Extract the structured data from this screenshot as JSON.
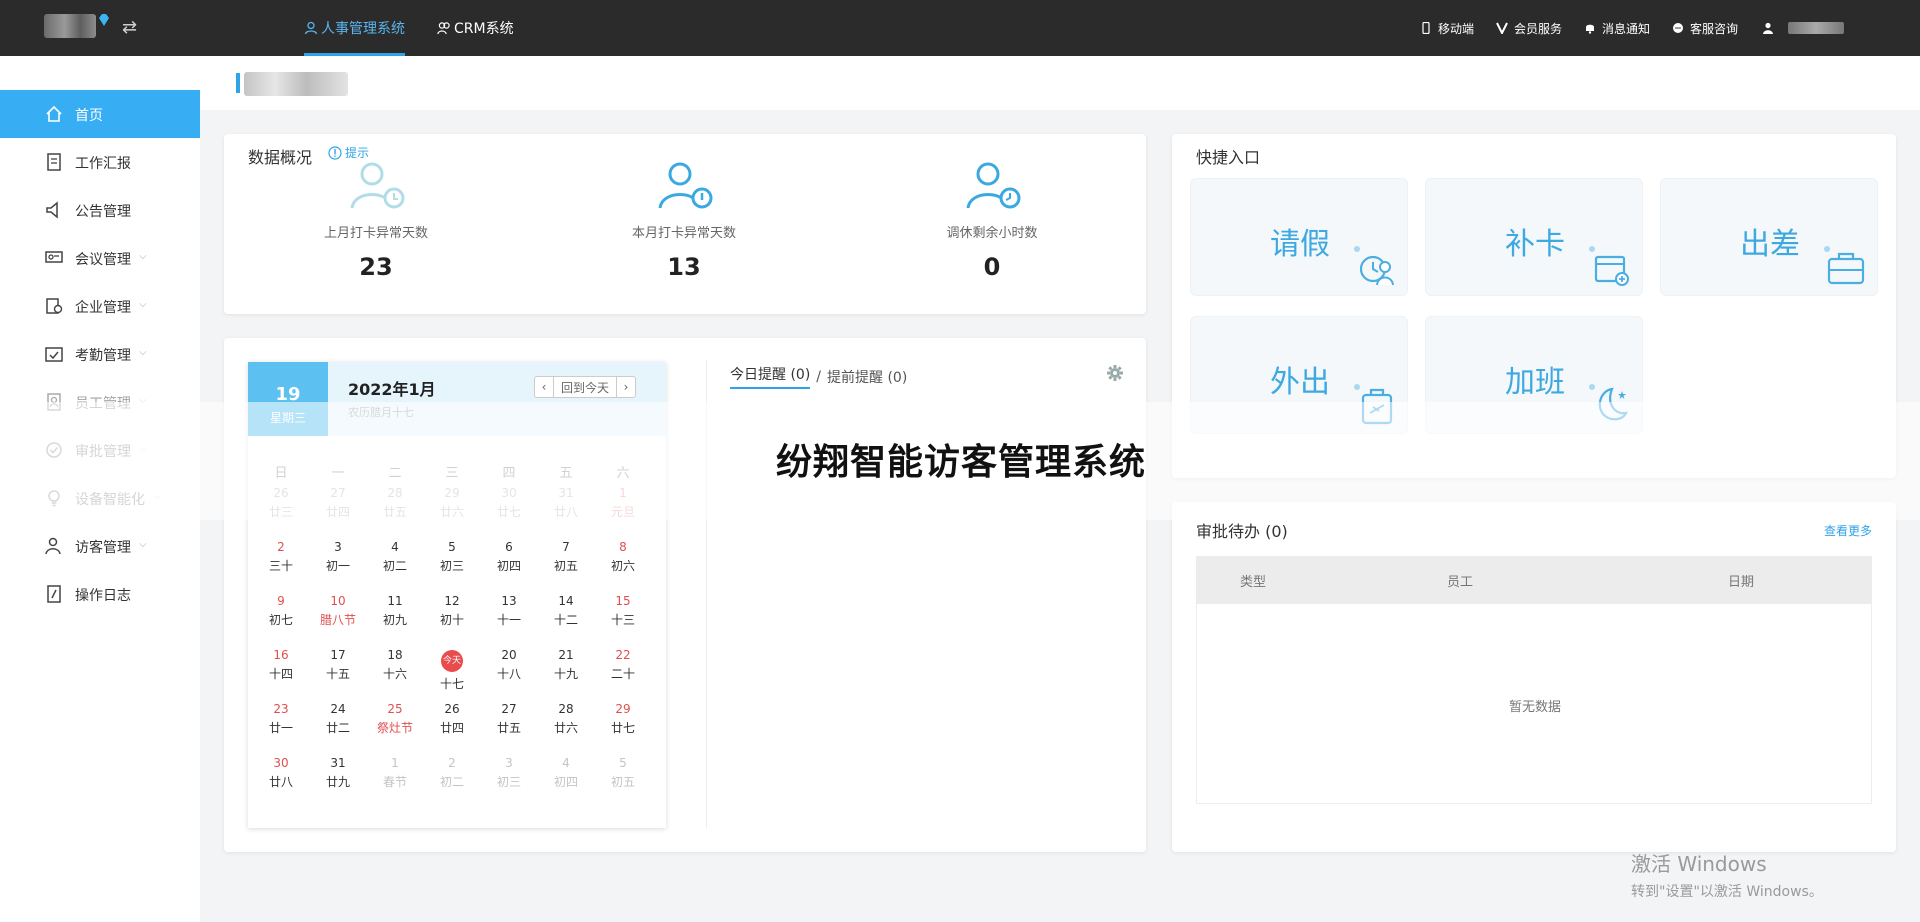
{
  "topbar": {
    "systems": [
      {
        "label": "人事管理系统",
        "active": true
      },
      {
        "label": "CRM系统",
        "active": false
      }
    ],
    "right_items": [
      {
        "label": "移动端",
        "icon": "mobile-icon"
      },
      {
        "label": "会员服务",
        "icon": "vip-icon"
      },
      {
        "label": "消息通知",
        "icon": "bell-icon"
      },
      {
        "label": "客服咨询",
        "icon": "chat-icon"
      }
    ],
    "accent": "#2fa3e6"
  },
  "sidebar": {
    "items": [
      {
        "label": "首页",
        "icon": "home-icon",
        "active": true,
        "expandable": false
      },
      {
        "label": "工作汇报",
        "icon": "document-icon",
        "active": false,
        "expandable": false
      },
      {
        "label": "公告管理",
        "icon": "megaphone-icon",
        "active": false,
        "expandable": false
      },
      {
        "label": "会议管理",
        "icon": "meeting-icon",
        "active": false,
        "expandable": true
      },
      {
        "label": "企业管理",
        "icon": "enterprise-icon",
        "active": false,
        "expandable": true
      },
      {
        "label": "考勤管理",
        "icon": "calendar-check-icon",
        "active": false,
        "expandable": true
      },
      {
        "label": "员工管理",
        "icon": "employee-icon",
        "active": false,
        "expandable": true
      },
      {
        "label": "审批管理",
        "icon": "approve-icon",
        "active": false,
        "expandable": true
      },
      {
        "label": "设备智能化",
        "icon": "bulb-icon",
        "active": false,
        "expandable": true
      },
      {
        "label": "访客管理",
        "icon": "visitor-icon",
        "active": false,
        "expandable": true
      },
      {
        "label": "操作日志",
        "icon": "log-icon",
        "active": false,
        "expandable": false
      }
    ]
  },
  "overview": {
    "title": "数据概况",
    "hint": "提示",
    "stats": [
      {
        "label": "上月打卡异常天数",
        "value": "23"
      },
      {
        "label": "本月打卡异常天数",
        "value": "13"
      },
      {
        "label": "调休剩余小时数",
        "value": "0"
      }
    ]
  },
  "quick": {
    "title": "快捷入口",
    "items": [
      {
        "label": "请假",
        "icon": "leave-icon"
      },
      {
        "label": "补卡",
        "icon": "card-supplement-icon"
      },
      {
        "label": "出差",
        "icon": "briefcase-icon"
      },
      {
        "label": "外出",
        "icon": "luggage-icon"
      },
      {
        "label": "加班",
        "icon": "moon-icon"
      }
    ]
  },
  "calendar": {
    "day_number": "19",
    "weekday": "星期三",
    "year_month": "2022年1月",
    "lunar": "农历腊月十七",
    "today_button": "回到今天",
    "prev": "‹",
    "next": "›",
    "weekdays": [
      "日",
      "一",
      "二",
      "三",
      "四",
      "五",
      "六"
    ],
    "weeks": [
      [
        {
          "d": "26",
          "l": "廿三",
          "o": true,
          "w": false,
          "f": false
        },
        {
          "d": "27",
          "l": "廿四",
          "o": true,
          "w": false,
          "f": false
        },
        {
          "d": "28",
          "l": "廿五",
          "o": true,
          "w": false,
          "f": false
        },
        {
          "d": "29",
          "l": "廿六",
          "o": true,
          "w": false,
          "f": false
        },
        {
          "d": "30",
          "l": "廿七",
          "o": true,
          "w": false,
          "f": false
        },
        {
          "d": "31",
          "l": "廿八",
          "o": true,
          "w": false,
          "f": false
        },
        {
          "d": "1",
          "l": "元旦",
          "o": true,
          "w": true,
          "f": true
        }
      ],
      [
        {
          "d": "2",
          "l": "三十",
          "o": false,
          "w": true,
          "f": false
        },
        {
          "d": "3",
          "l": "初一",
          "o": false,
          "w": false,
          "f": false
        },
        {
          "d": "4",
          "l": "初二",
          "o": false,
          "w": false,
          "f": false
        },
        {
          "d": "5",
          "l": "初三",
          "o": false,
          "w": false,
          "f": false
        },
        {
          "d": "6",
          "l": "初四",
          "o": false,
          "w": false,
          "f": false
        },
        {
          "d": "7",
          "l": "初五",
          "o": false,
          "w": false,
          "f": false
        },
        {
          "d": "8",
          "l": "初六",
          "o": false,
          "w": true,
          "f": false
        }
      ],
      [
        {
          "d": "9",
          "l": "初七",
          "o": false,
          "w": true,
          "f": false
        },
        {
          "d": "10",
          "l": "腊八节",
          "o": false,
          "w": true,
          "f": true
        },
        {
          "d": "11",
          "l": "初九",
          "o": false,
          "w": false,
          "f": false
        },
        {
          "d": "12",
          "l": "初十",
          "o": false,
          "w": false,
          "f": false
        },
        {
          "d": "13",
          "l": "十一",
          "o": false,
          "w": false,
          "f": false
        },
        {
          "d": "14",
          "l": "十二",
          "o": false,
          "w": false,
          "f": false
        },
        {
          "d": "15",
          "l": "十三",
          "o": false,
          "w": true,
          "f": false
        }
      ],
      [
        {
          "d": "16",
          "l": "十四",
          "o": false,
          "w": true,
          "f": false
        },
        {
          "d": "17",
          "l": "十五",
          "o": false,
          "w": false,
          "f": false
        },
        {
          "d": "18",
          "l": "十六",
          "o": false,
          "w": false,
          "f": false
        },
        {
          "d": "今天",
          "l": "十七",
          "o": false,
          "w": false,
          "f": false,
          "t": true
        },
        {
          "d": "20",
          "l": "十八",
          "o": false,
          "w": false,
          "f": false
        },
        {
          "d": "21",
          "l": "十九",
          "o": false,
          "w": false,
          "f": false
        },
        {
          "d": "22",
          "l": "二十",
          "o": false,
          "w": true,
          "f": false
        }
      ],
      [
        {
          "d": "23",
          "l": "廿一",
          "o": false,
          "w": true,
          "f": false
        },
        {
          "d": "24",
          "l": "廿二",
          "o": false,
          "w": false,
          "f": false
        },
        {
          "d": "25",
          "l": "祭灶节",
          "o": false,
          "w": true,
          "f": true
        },
        {
          "d": "26",
          "l": "廿四",
          "o": false,
          "w": false,
          "f": false
        },
        {
          "d": "27",
          "l": "廿五",
          "o": false,
          "w": false,
          "f": false
        },
        {
          "d": "28",
          "l": "廿六",
          "o": false,
          "w": false,
          "f": false
        },
        {
          "d": "29",
          "l": "廿七",
          "o": false,
          "w": true,
          "f": false
        }
      ],
      [
        {
          "d": "30",
          "l": "廿八",
          "o": false,
          "w": true,
          "f": false
        },
        {
          "d": "31",
          "l": "廿九",
          "o": false,
          "w": false,
          "f": false
        },
        {
          "d": "1",
          "l": "春节",
          "o": true,
          "w": false,
          "f": false
        },
        {
          "d": "2",
          "l": "初二",
          "o": true,
          "w": false,
          "f": false
        },
        {
          "d": "3",
          "l": "初三",
          "o": true,
          "w": false,
          "f": false
        },
        {
          "d": "4",
          "l": "初四",
          "o": true,
          "w": false,
          "f": false
        },
        {
          "d": "5",
          "l": "初五",
          "o": true,
          "w": false,
          "f": false
        }
      ]
    ]
  },
  "reminders": {
    "today_label": "今日提醒",
    "today_count": "(0)",
    "separator": "/",
    "advance_label": "提前提醒",
    "advance_count": "(0)"
  },
  "watermark": "纷翔智能访客管理系统",
  "approval": {
    "title": "审批待办",
    "count": "(0)",
    "more": "查看更多",
    "columns": [
      "类型",
      "员工",
      "日期"
    ],
    "empty": "暂无数据"
  },
  "windows": {
    "line1": "激活 Windows",
    "line2": "转到\"设置\"以激活 Windows。"
  }
}
